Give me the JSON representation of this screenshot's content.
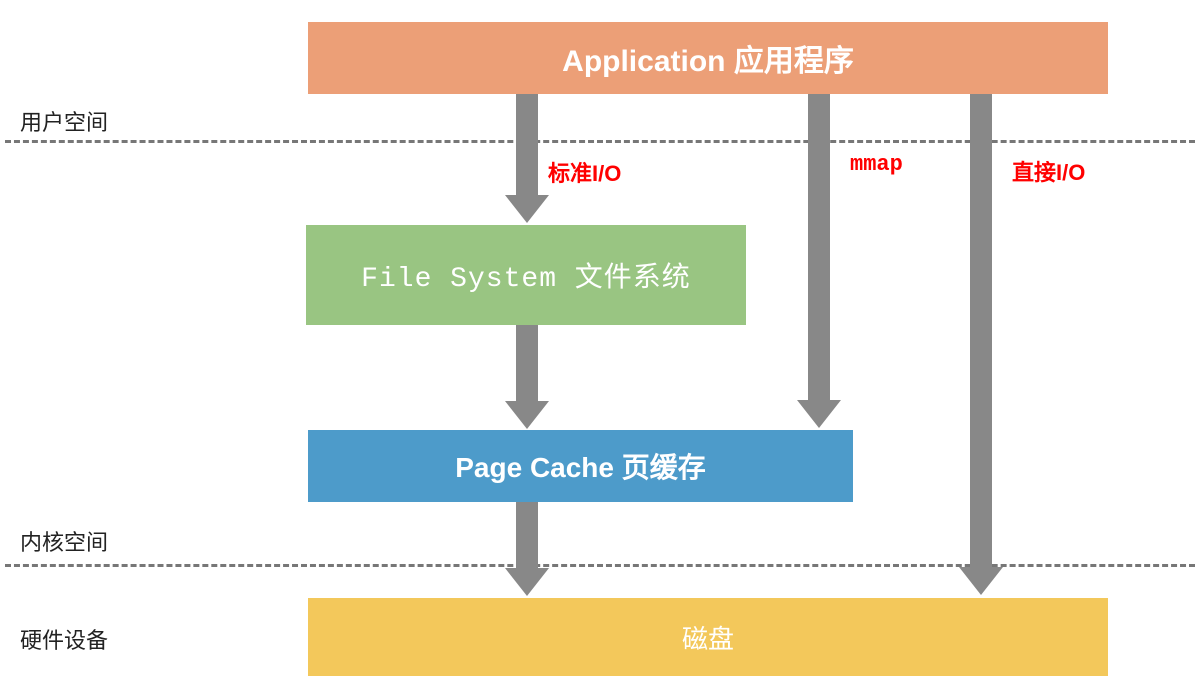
{
  "sections": {
    "user_space": "用户空间",
    "kernel_space": "内核空间",
    "hardware": "硬件设备"
  },
  "boxes": {
    "application": "Application 应用程序",
    "file_system": "File System 文件系统",
    "page_cache": "Page Cache 页缓存",
    "disk": "磁盘"
  },
  "arrows": {
    "standard_io": "标准I/O",
    "mmap": "mmap",
    "direct_io": "直接I/O"
  },
  "colors": {
    "application": "#ec9f77",
    "file_system": "#99c582",
    "page_cache": "#4d9bca",
    "disk": "#f3c85b",
    "arrow": "#888888",
    "label_red": "#ff0000"
  }
}
